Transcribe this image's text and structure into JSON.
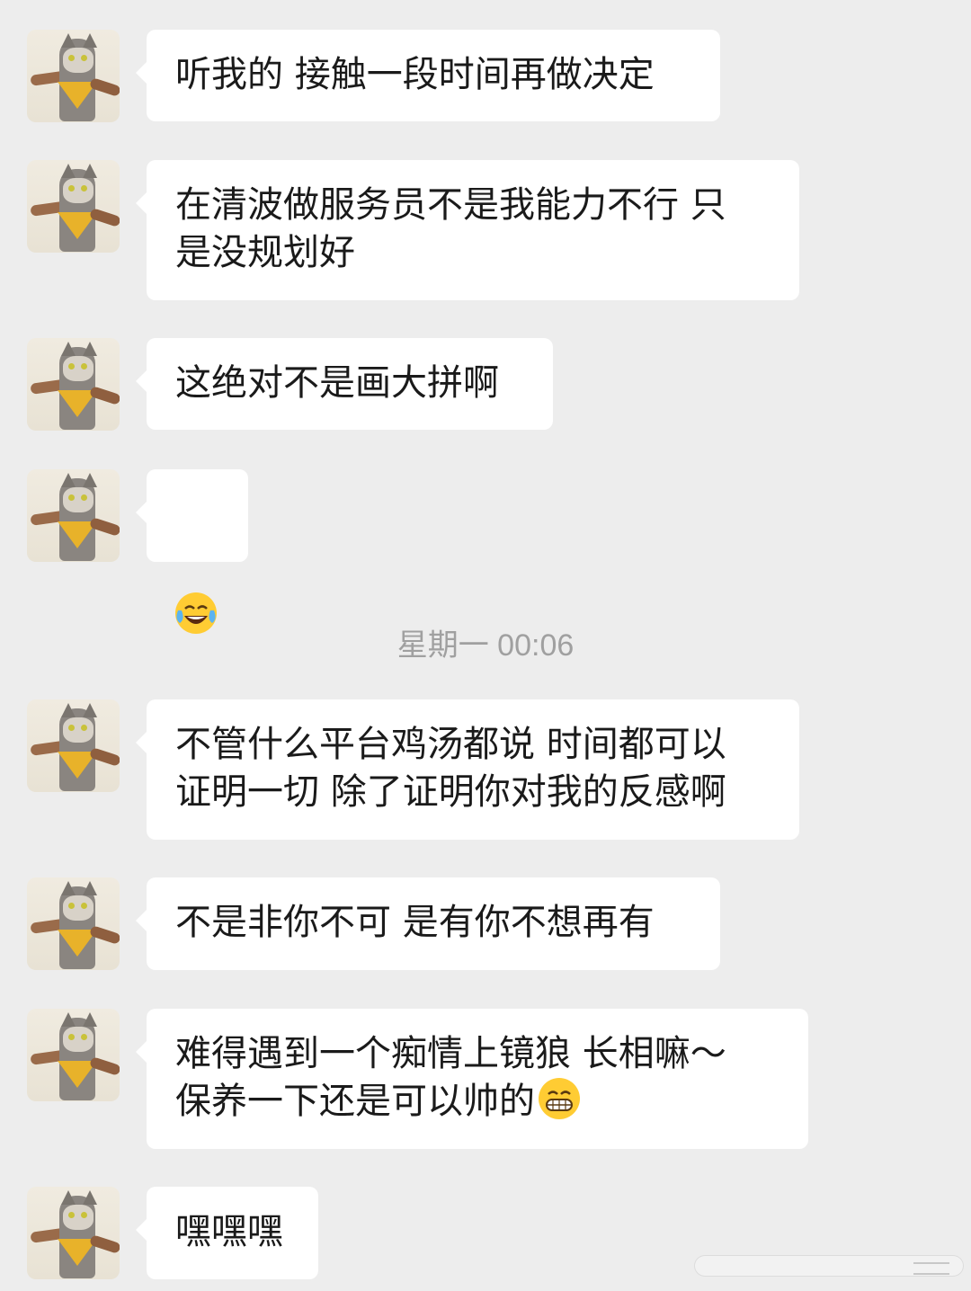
{
  "messages": [
    {
      "text": "听我的 接触一段时间再做决定"
    },
    {
      "text": "在清波做服务员不是我能力不行 只\n是没规划好"
    },
    {
      "text": "这绝对不是画大拼啊"
    },
    {
      "emoji": "face-with-tears-of-joy"
    },
    {
      "text": "不管什么平台鸡汤都说 时间都可以\n证明一切 除了证明你对我的反感啊"
    },
    {
      "text": "不是非你不可 是有你不想再有"
    },
    {
      "text": "难得遇到一个痴情上镜狼 长相嘛～\n保养一下还是可以帅的",
      "trailing_emoji": "grinning-face-with-smiling-eyes"
    },
    {
      "text": "嘿嘿嘿"
    }
  ],
  "timestamp": "星期一 00:06",
  "avatar": {
    "icon": "cat-avatar-icon"
  },
  "colors": {
    "background": "#ededed",
    "bubble": "#ffffff",
    "text": "#1a1a1a",
    "timestamp": "#a0a0a0"
  }
}
